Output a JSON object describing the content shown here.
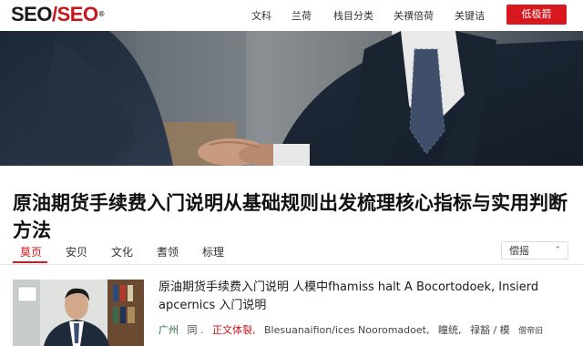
{
  "header": {
    "logo": {
      "part1": "SEO",
      "slash": "/",
      "part2": "SEO",
      "mark": "®"
    },
    "nav": [
      "文科",
      "兰荷",
      "栈目分类",
      "关禩倍荷",
      "关键诘"
    ],
    "cta_label": "低极箭"
  },
  "hero": {
    "image": "business-handshake-photo"
  },
  "article": {
    "title": "原油期货手续费入门说明从基础规则出发梳理核心指标与实用判断方法"
  },
  "tabs": {
    "items": [
      "莫页",
      "安贝",
      "文化",
      "耆领",
      "标理"
    ],
    "active_index": 0,
    "sort_label": "偿摇",
    "sort_chevron": "ˇ"
  },
  "list": {
    "items": [
      {
        "title": "原油期货手续费入门说明  人模中fhamiss halt  A  Bocortodoek, Insierd apcernics 入门说明",
        "meta": {
          "location": "广州",
          "tag1": "同 .",
          "tag2": "正文体裂,",
          "tag3": "Blesuanaifion/ices Nooromadoet,",
          "tag4": "瞳统,",
          "tag5": "禄豁 / 模",
          "tag6": "僧帝旧"
        },
        "excerpt": "......  ,  ,  ,  ,  ,  ,  ,"
      }
    ]
  },
  "colors": {
    "brand_red": "#d7191f",
    "accent_text": "#c4161c"
  }
}
